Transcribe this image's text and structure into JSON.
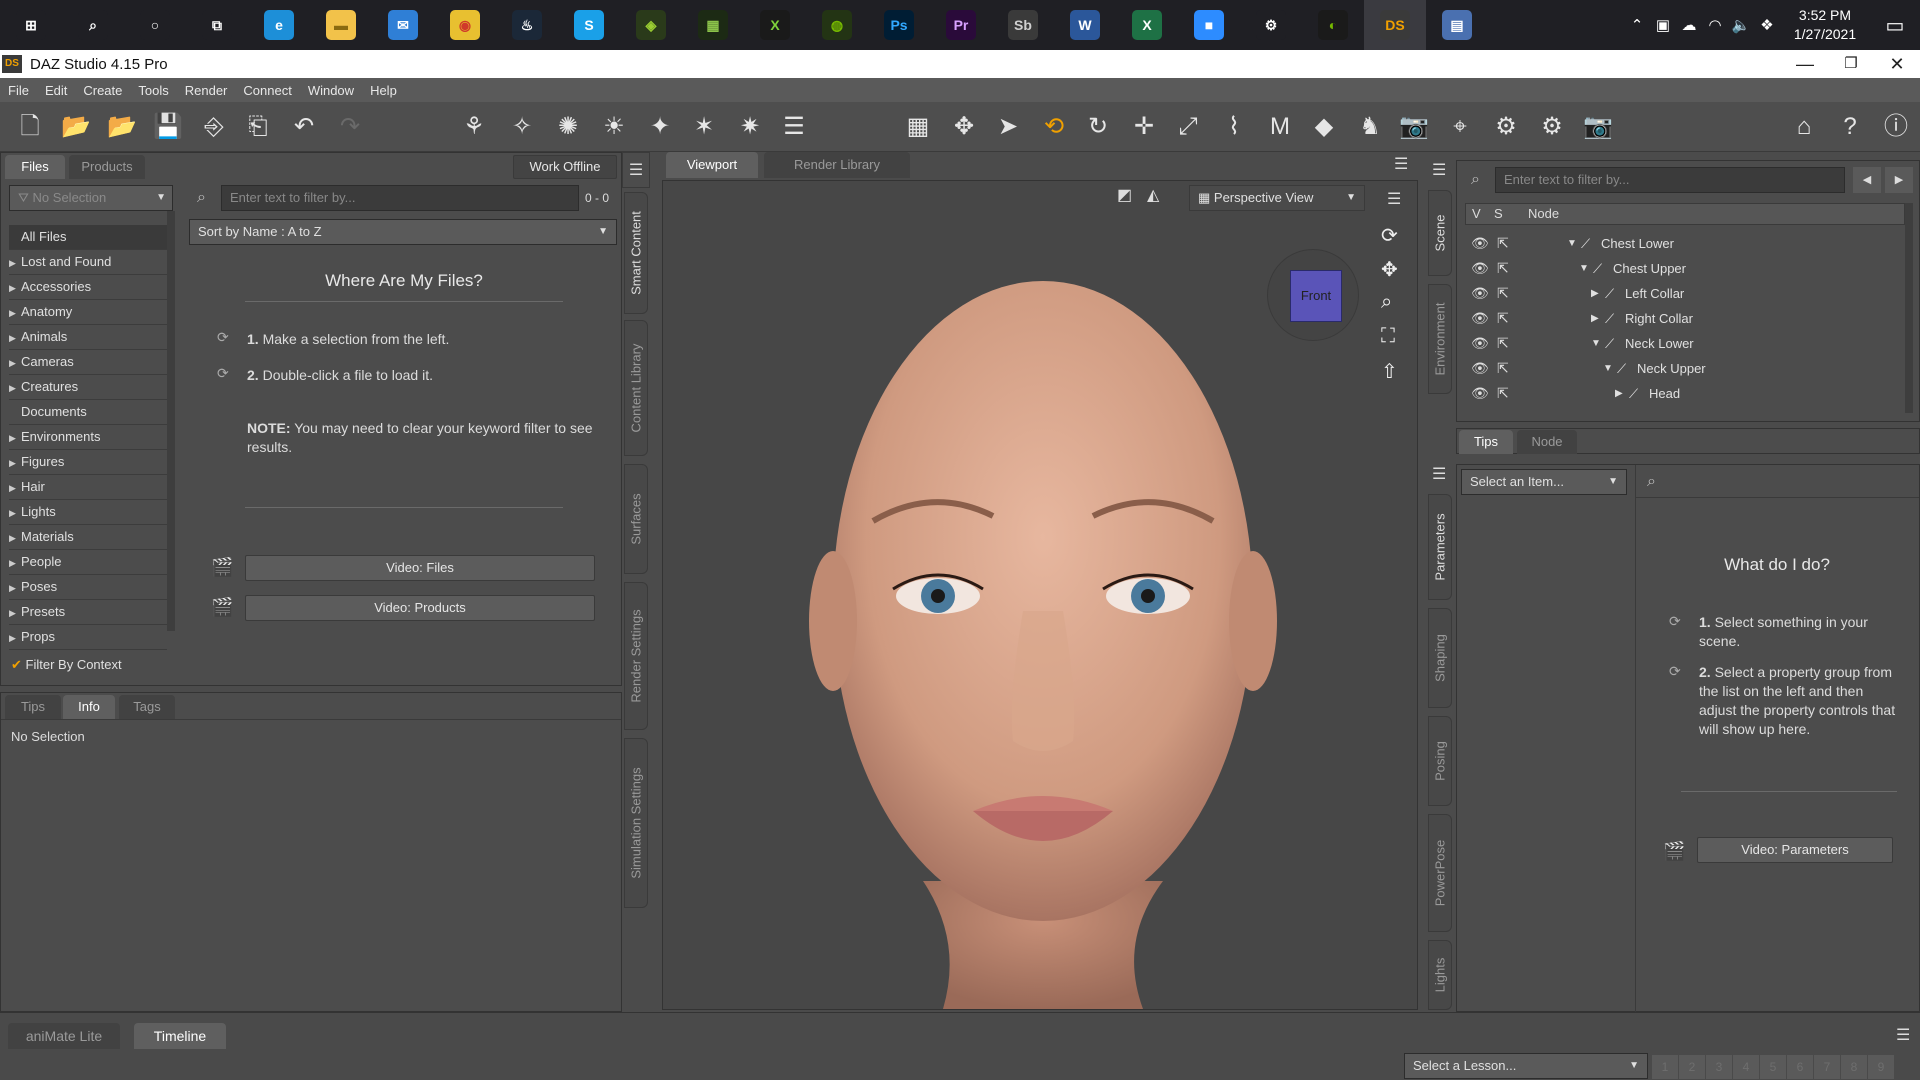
{
  "taskbar": {
    "apps": [
      {
        "name": "windows-start-icon",
        "glyph": "⊞",
        "color": "#1f1f24",
        "fg": "#ffffff"
      },
      {
        "name": "search-icon",
        "glyph": "⌕",
        "color": "#1f1f24",
        "fg": "#ffffff"
      },
      {
        "name": "cortana-icon",
        "glyph": "○",
        "color": "#1f1f24",
        "fg": "#ffffff"
      },
      {
        "name": "task-view-icon",
        "glyph": "⧉",
        "color": "#1f1f24",
        "fg": "#ffffff"
      },
      {
        "name": "edge-icon",
        "glyph": "e",
        "color": "#1d8fd8",
        "fg": "#ffffff"
      },
      {
        "name": "file-explorer-icon",
        "glyph": "▬",
        "color": "#f2c24a",
        "fg": "#8a6a10"
      },
      {
        "name": "mail-icon",
        "glyph": "✉",
        "color": "#2f7fd6",
        "fg": "#ffffff"
      },
      {
        "name": "chrome-icon",
        "glyph": "◉",
        "color": "#e8c030",
        "fg": "#d03a2a"
      },
      {
        "name": "steam-icon",
        "glyph": "♨",
        "color": "#1b2838",
        "fg": "#ffffff"
      },
      {
        "name": "skype-icon",
        "glyph": "S",
        "color": "#1aa0e8",
        "fg": "#ffffff"
      },
      {
        "name": "app-green-icon",
        "glyph": "◈",
        "color": "#2a3a1a",
        "fg": "#9acd32"
      },
      {
        "name": "app-gpu-icon",
        "glyph": "▦",
        "color": "#1c2a14",
        "fg": "#8bc34a"
      },
      {
        "name": "xtreme-icon",
        "glyph": "X",
        "color": "#1a1a1a",
        "fg": "#7fd13b"
      },
      {
        "name": "nvidia-icon",
        "glyph": "◍",
        "color": "#233414",
        "fg": "#76b900"
      },
      {
        "name": "photoshop-icon",
        "glyph": "Ps",
        "color": "#001d34",
        "fg": "#31a8ff"
      },
      {
        "name": "premiere-icon",
        "glyph": "Pr",
        "color": "#2a0a3a",
        "fg": "#d8a0ff"
      },
      {
        "name": "substance-icon",
        "glyph": "Sb",
        "color": "#3a3a3a",
        "fg": "#cfcfcf"
      },
      {
        "name": "word-icon",
        "glyph": "W",
        "color": "#2b579a",
        "fg": "#ffffff"
      },
      {
        "name": "excel-icon",
        "glyph": "X",
        "color": "#1e7145",
        "fg": "#ffffff"
      },
      {
        "name": "zoom-icon",
        "glyph": "■",
        "color": "#2d8cff",
        "fg": "#ffffff"
      },
      {
        "name": "settings-icon",
        "glyph": "⚙",
        "color": "#1f1f24",
        "fg": "#ffffff"
      },
      {
        "name": "nvidia-geforce-icon",
        "glyph": "◐",
        "color": "#1a1a1a",
        "fg": "#76b900"
      },
      {
        "name": "daz-studio-icon",
        "glyph": "DS",
        "color": "#3a3a3a",
        "fg": "#f0a000"
      },
      {
        "name": "app-blue-icon",
        "glyph": "▤",
        "color": "#4a70b0",
        "fg": "#ffffff"
      }
    ],
    "tray": [
      "chevron-up-icon",
      "meet-now-icon",
      "onedrive-icon",
      "wifi-icon",
      "volume-icon",
      "dropbox-icon"
    ],
    "clock_time": "3:52 PM",
    "clock_date": "1/27/2021"
  },
  "window": {
    "title": "DAZ Studio 4.15 Pro",
    "app_badge": "DS"
  },
  "menu": [
    "File",
    "Edit",
    "Create",
    "Tools",
    "Render",
    "Connect",
    "Window",
    "Help"
  ],
  "left_panel": {
    "tabs": [
      "Files",
      "Products"
    ],
    "work_offline": "Work Offline",
    "no_selection_dropdown": "No Selection",
    "filter_placeholder": "Enter text to filter by...",
    "filter_count": "0 - 0",
    "sort": "Sort by Name : A to Z",
    "categories": [
      "All Files",
      "Lost and Found",
      "Accessories",
      "Anatomy",
      "Animals",
      "Cameras",
      "Creatures",
      "Documents",
      "Environments",
      "Figures",
      "Hair",
      "Lights",
      "Materials",
      "People",
      "Poses",
      "Presets",
      "Props"
    ],
    "filter_by_context": "Filter By Context",
    "heading": "Where Are My Files?",
    "step1_num": "1.",
    "step1": "Make a selection from the left.",
    "step2_num": "2.",
    "step2": "Double-click a file to load it.",
    "note_label": "NOTE:",
    "note": "You may need to clear your keyword filter to see results.",
    "video_files": "Video: Files",
    "video_products": "Video:  Products",
    "info_tabs": [
      "Tips",
      "Info",
      "Tags"
    ],
    "info_text": "No Selection"
  },
  "side_tabs_left": [
    "Smart Content",
    "Content Library",
    "Surfaces",
    "Render Settings",
    "Simulation Settings"
  ],
  "viewport": {
    "tabs": [
      "Viewport",
      "Render Library"
    ],
    "view_select": "Perspective View",
    "cube_label": "Front"
  },
  "scene": {
    "filter_placeholder": "Enter text to filter by...",
    "col_v": "V",
    "col_s": "S",
    "col_node": "Node",
    "nodes": [
      {
        "label": "Chest Lower",
        "depth": 0,
        "arrow": "▼"
      },
      {
        "label": "Chest Upper",
        "depth": 1,
        "arrow": "▼"
      },
      {
        "label": "Left Collar",
        "depth": 2,
        "arrow": "▶"
      },
      {
        "label": "Right Collar",
        "depth": 2,
        "arrow": "▶"
      },
      {
        "label": "Neck Lower",
        "depth": 2,
        "arrow": "▼"
      },
      {
        "label": "Neck Upper",
        "depth": 3,
        "arrow": "▼"
      },
      {
        "label": "Head",
        "depth": 4,
        "arrow": "▶"
      }
    ],
    "bottom_tabs": [
      "Tips",
      "Node"
    ]
  },
  "side_tabs_right": [
    "Scene",
    "Environment",
    "Parameters",
    "Shaping",
    "Posing",
    "PowerPose",
    "Lights"
  ],
  "parameters": {
    "select_item": "Select an Item...",
    "heading": "What do I do?",
    "step1_num": "1.",
    "step1": "Select something in your scene.",
    "step2_num": "2.",
    "step2": "Select a property group from the list on the left and then adjust the property controls that will show up here.",
    "video": "Video: Parameters"
  },
  "bottom": {
    "tabs": [
      "aniMate Lite",
      "Timeline"
    ],
    "lesson": "Select a Lesson...",
    "pages": [
      "1",
      "2",
      "3",
      "4",
      "5",
      "6",
      "7",
      "8",
      "9"
    ]
  },
  "colors": {
    "accent": "#f0a000",
    "panel": "#4a4a4a",
    "viewport_bg": "#474747",
    "cube": "#5a54b8"
  }
}
